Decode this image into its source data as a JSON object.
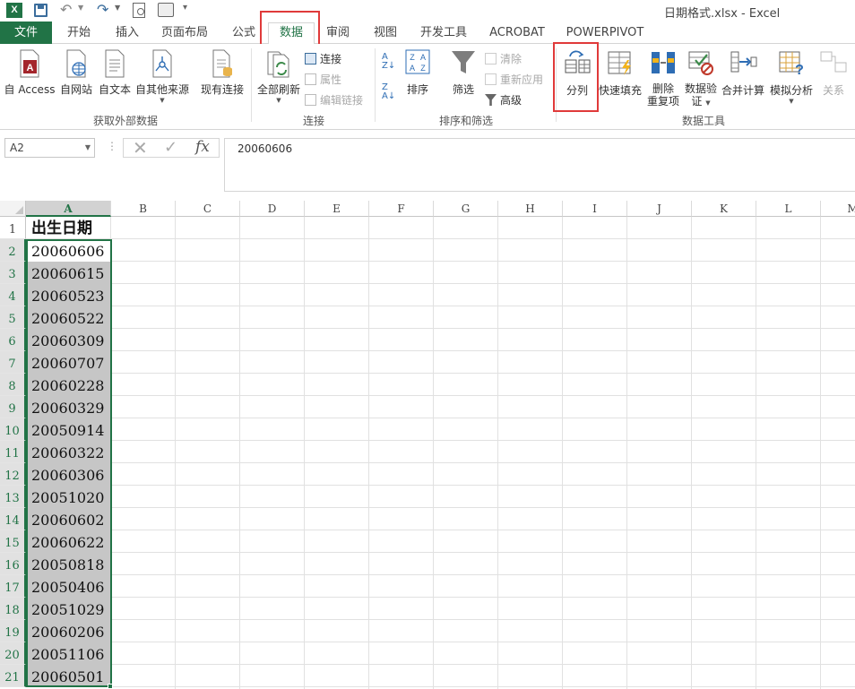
{
  "window": {
    "title": "日期格式.xlsx - Excel",
    "app_icon_letter": "X"
  },
  "tabs": [
    "文件",
    "开始",
    "插入",
    "页面布局",
    "公式",
    "数据",
    "审阅",
    "视图",
    "开发工具",
    "ACROBAT",
    "POWERPIVOT"
  ],
  "ribbon": {
    "external_data": {
      "from_access": "自 Access",
      "from_web": "自网站",
      "from_text": "自文本",
      "from_other": "自其他来源",
      "existing_connections": "现有连接",
      "group_label": "获取外部数据"
    },
    "connections": {
      "refresh_all": "全部刷新",
      "connections": "连接",
      "properties": "属性",
      "edit_links": "编辑链接",
      "group_label": "连接"
    },
    "sort_filter": {
      "sort": "排序",
      "filter": "筛选",
      "clear": "清除",
      "reapply": "重新应用",
      "advanced": "高级",
      "group_label": "排序和筛选"
    },
    "data_tools": {
      "text_to_columns": "分列",
      "flash_fill": "快速填充",
      "remove_duplicates_1": "删除",
      "remove_duplicates_2": "重复项",
      "data_validation_1": "数据验",
      "data_validation_2": "证",
      "consolidate": "合并计算",
      "what_if": "模拟分析",
      "relationships": "关系",
      "group_label": "数据工具"
    }
  },
  "formula_bar": {
    "name_box": "A2",
    "fx": "fx",
    "value": "20060606"
  },
  "sheet": {
    "columns": [
      "A",
      "B",
      "C",
      "D",
      "E",
      "F",
      "G",
      "H",
      "I",
      "J",
      "K",
      "L",
      "M"
    ],
    "rows": [
      "1",
      "2",
      "3",
      "4",
      "5",
      "6",
      "7",
      "8",
      "9",
      "10",
      "11",
      "12",
      "13",
      "14",
      "15",
      "16",
      "17",
      "18",
      "19",
      "20",
      "21"
    ],
    "column_a": [
      "出生日期",
      "20060606",
      "20060615",
      "20060523",
      "20060522",
      "20060309",
      "20060707",
      "20060228",
      "20060329",
      "20050914",
      "20060322",
      "20060306",
      "20051020",
      "20060602",
      "20060622",
      "20050818",
      "20050406",
      "20051029",
      "20060206",
      "20051106",
      "20060501"
    ]
  },
  "colors": {
    "accent": "#217346",
    "highlight_box": "#e03a3a",
    "selection_fill": "#c6c6c6"
  }
}
